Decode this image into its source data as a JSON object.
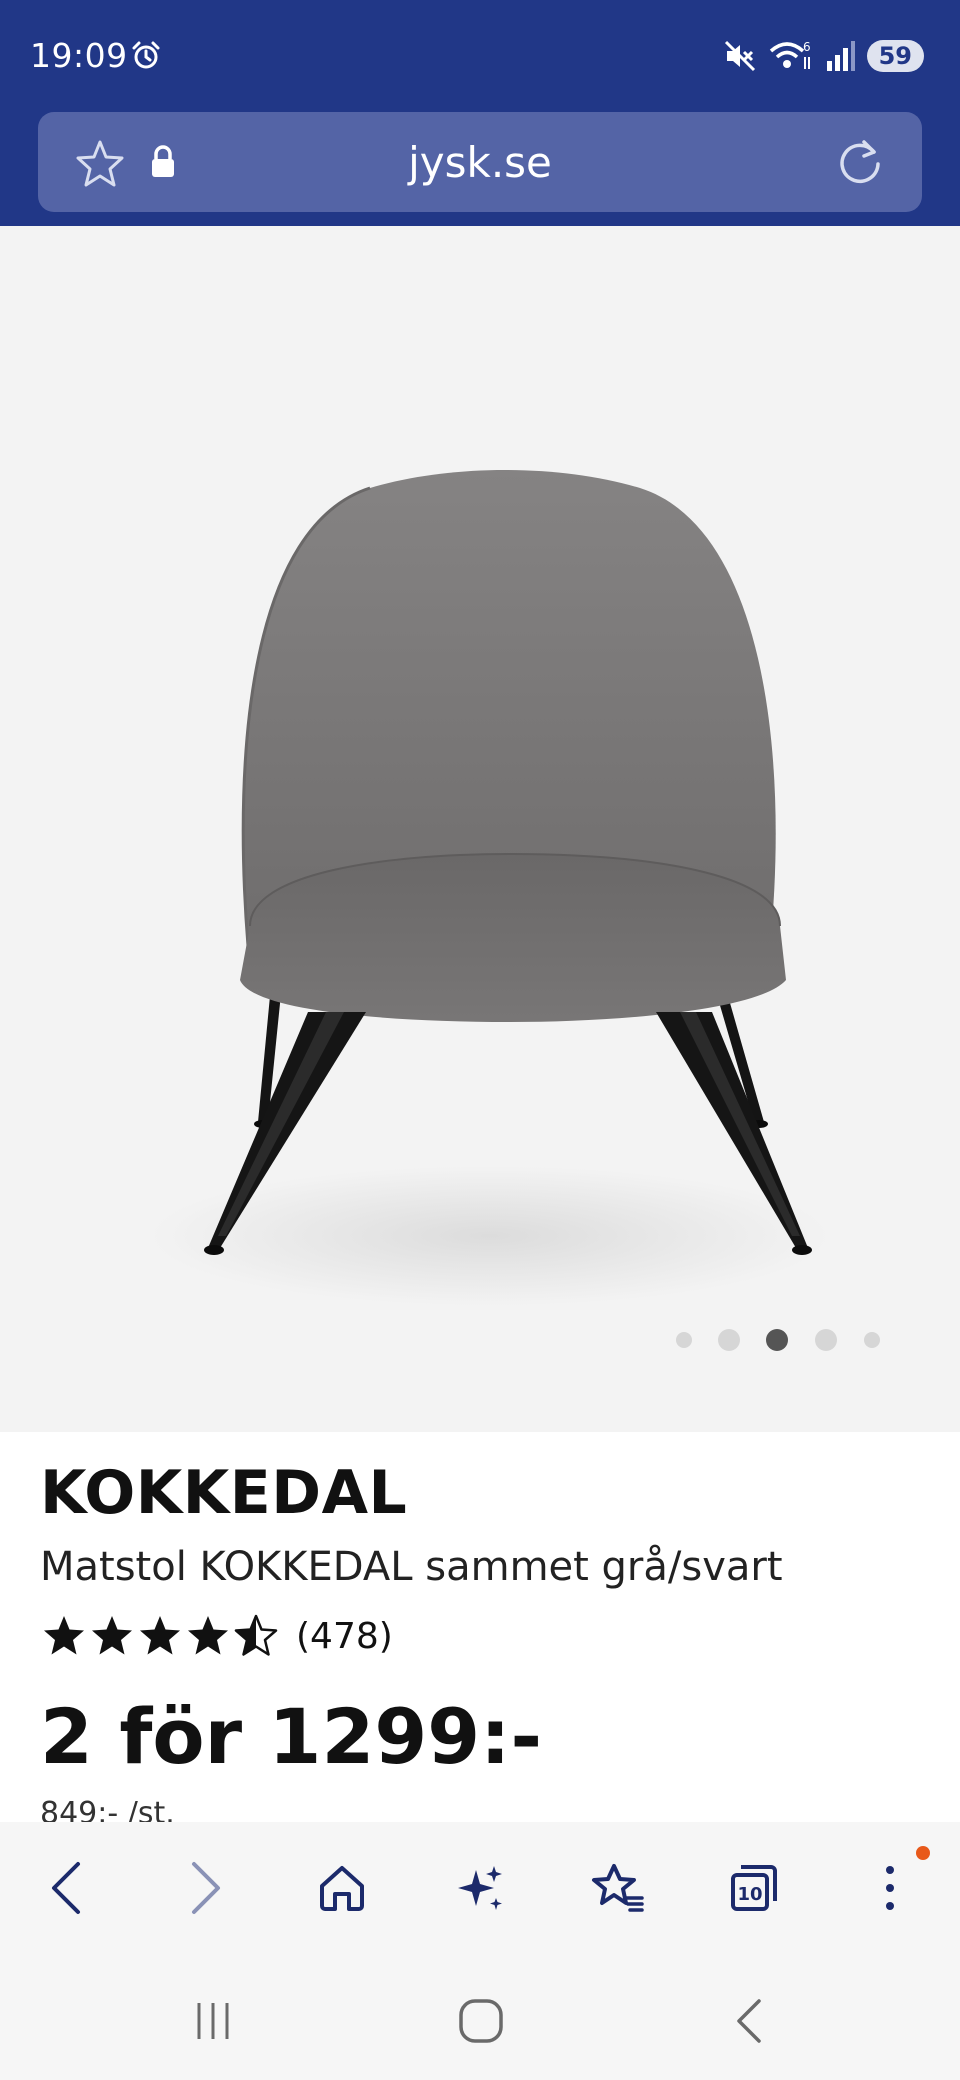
{
  "status_bar": {
    "time": "19:09",
    "battery": "59",
    "icons": [
      "alarm-icon",
      "mute-icon",
      "wifi-icon",
      "signal-icon"
    ]
  },
  "url_bar": {
    "domain": "jysk.se",
    "icons": [
      "star-icon",
      "lock-icon",
      "reload-icon"
    ]
  },
  "gallery": {
    "image_alt": "Matstol KOKKEDAL sammet grå/svart",
    "slide_count": 5,
    "active_index": 2
  },
  "product": {
    "brand": "KOKKEDAL",
    "name": "Matstol KOKKEDAL sammet grå/svart",
    "rating": 4.5,
    "rating_max": 5,
    "review_count": "(478)",
    "price": "2 för 1299:-",
    "unit_price": "849:- /st."
  },
  "bottom_nav": {
    "items": [
      "back-icon",
      "forward-icon",
      "home-icon",
      "ai-sparkle-icon",
      "bookmarks-icon",
      "tabs-icon",
      "menu-icon"
    ],
    "tab_count": "10"
  },
  "system_nav": {
    "items": [
      "recents-icon",
      "home-icon",
      "back-icon"
    ]
  },
  "colors": {
    "header": "#213787",
    "url_field": "#5464a6",
    "nav_icon": "#1c2a6b",
    "badge": "#e8591a"
  }
}
